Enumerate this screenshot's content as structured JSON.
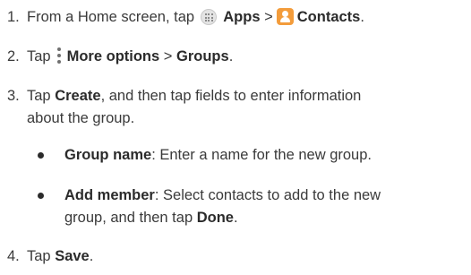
{
  "steps": [
    {
      "number": "1.",
      "pre": "From a Home screen, tap",
      "apps_label": "Apps",
      "separator": ">",
      "contacts_label": "Contacts",
      "end": "."
    },
    {
      "number": "2.",
      "pre": "Tap",
      "more_label": "More options",
      "separator": ">",
      "groups_label": "Groups",
      "end": "."
    },
    {
      "number": "3.",
      "pre": "Tap",
      "create_label": "Create",
      "rest_line1": ", and then tap fields to enter information",
      "rest_line2": "about the group."
    },
    {
      "number": "4.",
      "pre": "Tap",
      "save_label": "Save",
      "end": "."
    }
  ],
  "bullets": [
    {
      "term": "Group name",
      "desc": ": Enter a name for the new group."
    },
    {
      "term": "Add member",
      "desc_line1": ": Select contacts to add to the new",
      "desc_line2_pre": "group, and then tap",
      "done_label": "Done",
      "end": "."
    }
  ],
  "icons": {
    "apps": "apps-grid-icon",
    "contacts": "contacts-app-icon",
    "more": "more-options-icon"
  },
  "colors": {
    "text": "#3a3a3a",
    "contacts_icon": "#f39c3b"
  }
}
